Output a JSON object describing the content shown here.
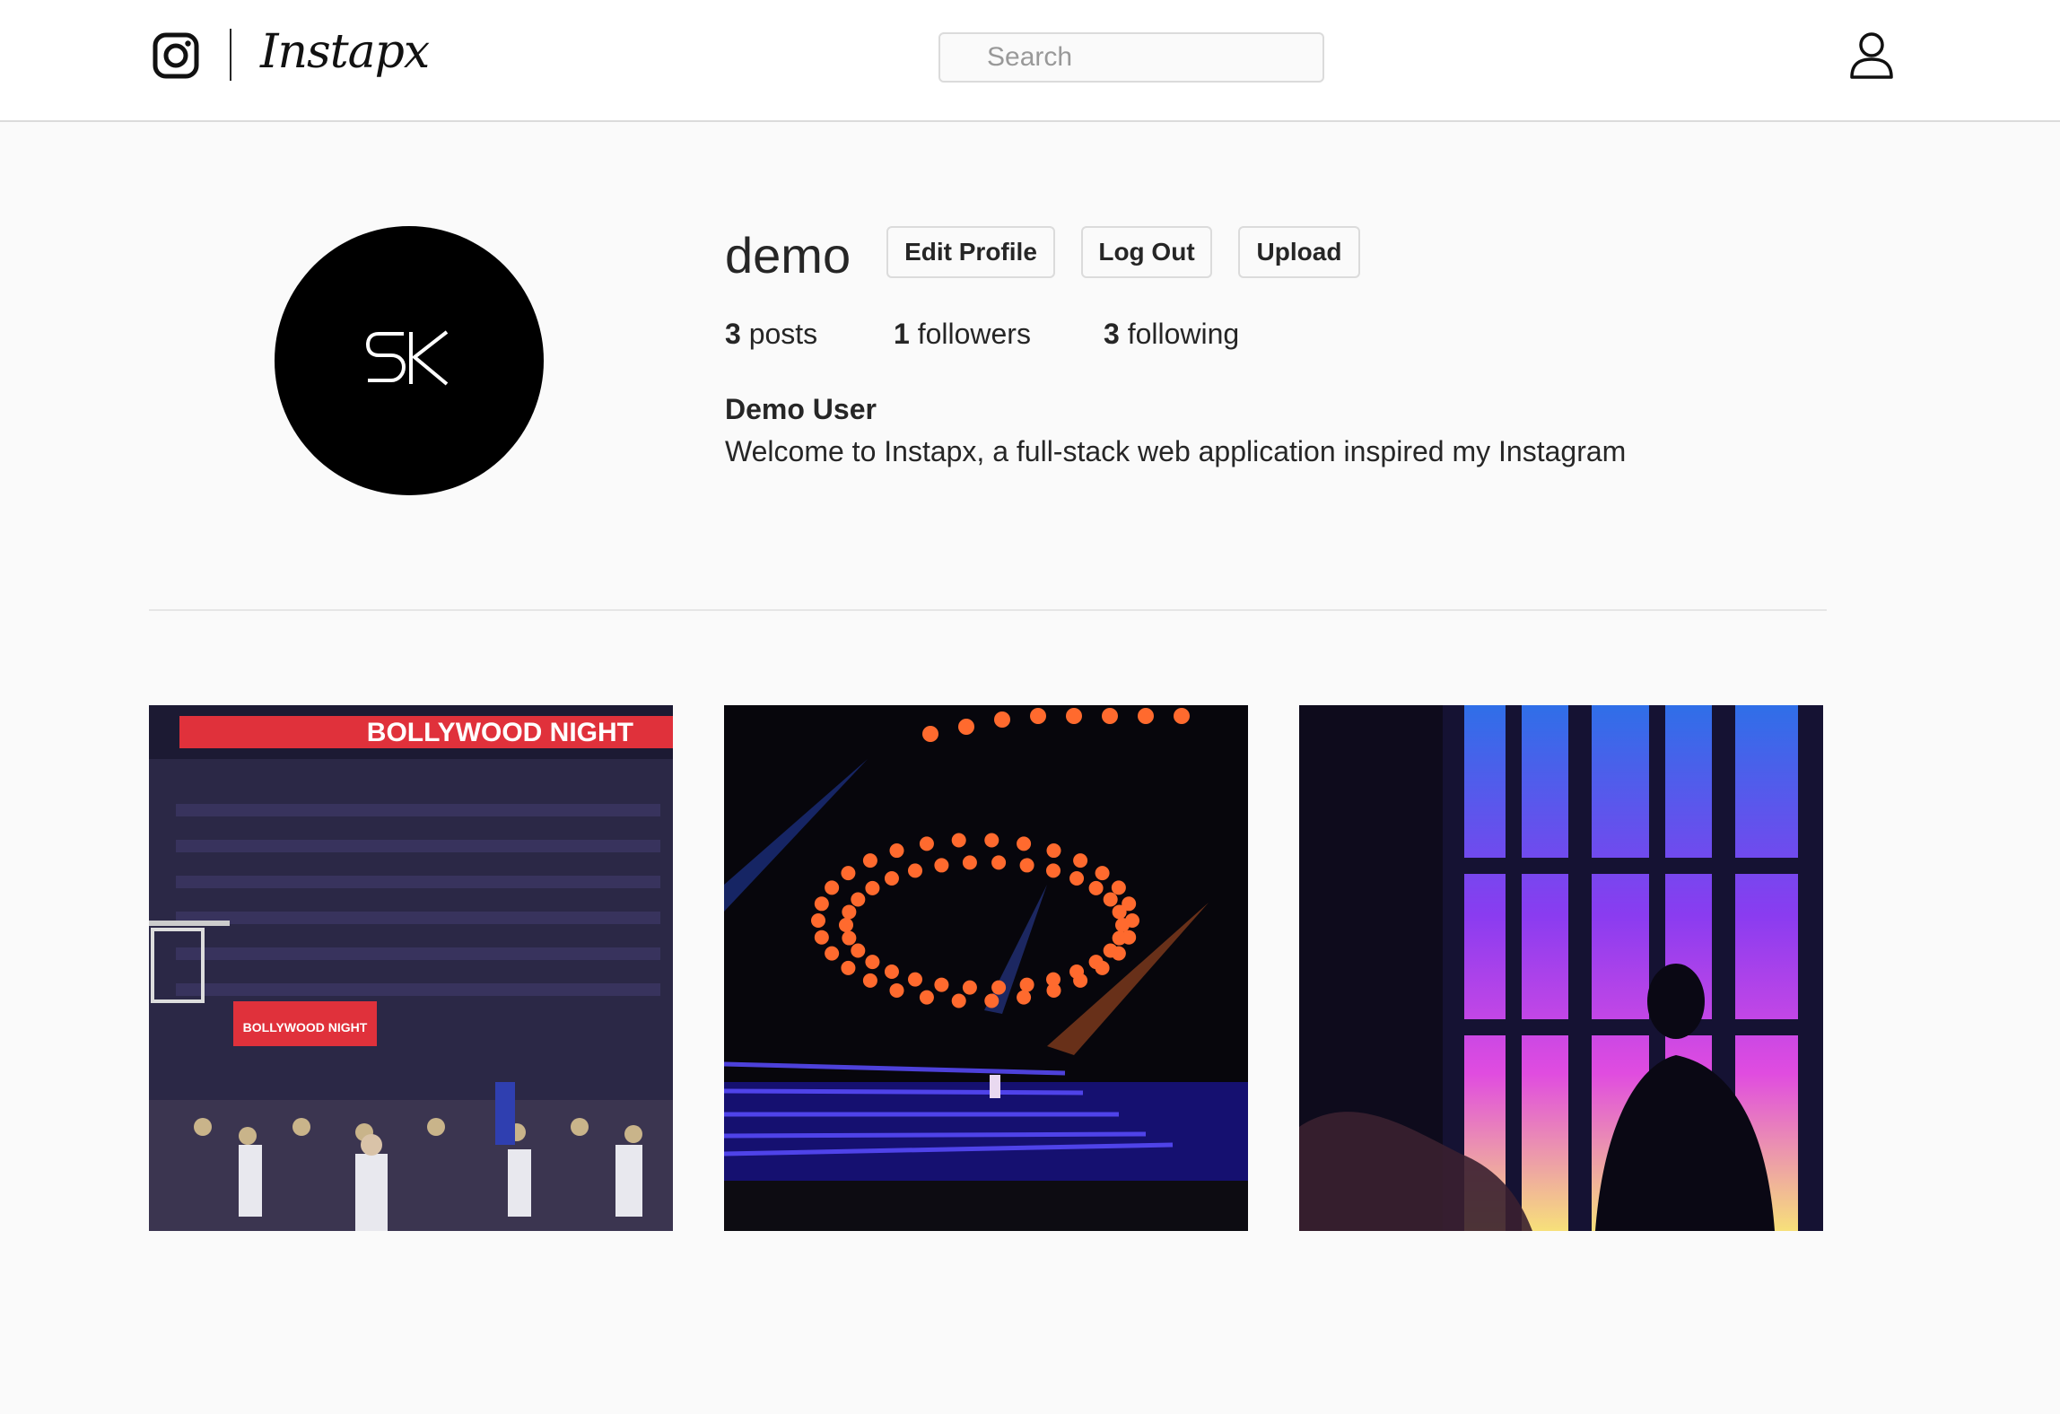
{
  "header": {
    "logo_icon": "instagram-camera-icon",
    "brand_name": "Instapx",
    "search_placeholder": "Search",
    "search_icon": "search-icon",
    "user_icon": "user-profile-icon"
  },
  "profile": {
    "avatar_monogram": "SK",
    "username": "demo",
    "buttons": {
      "edit": "Edit Profile",
      "logout": "Log Out",
      "upload": "Upload"
    },
    "stats": {
      "posts_count": "3",
      "posts_label": "posts",
      "followers_count": "1",
      "followers_label": "followers",
      "following_count": "3",
      "following_label": "following"
    },
    "full_name": "Demo User",
    "bio": "Welcome to Instapx, a full-stack web application inspired my Instagram"
  },
  "posts": [
    {
      "banner_text": "BOLLYWOOD NIGHT",
      "courtside_text": "BOLLYWOOD NIGHT"
    },
    {
      "banner_text": ""
    },
    {
      "banner_text": ""
    }
  ],
  "colors": {
    "page_background": "#fafafa",
    "header_background": "#ffffff",
    "border": "#dbdbdb",
    "text": "#262626",
    "banner_red": "#e0313b"
  }
}
